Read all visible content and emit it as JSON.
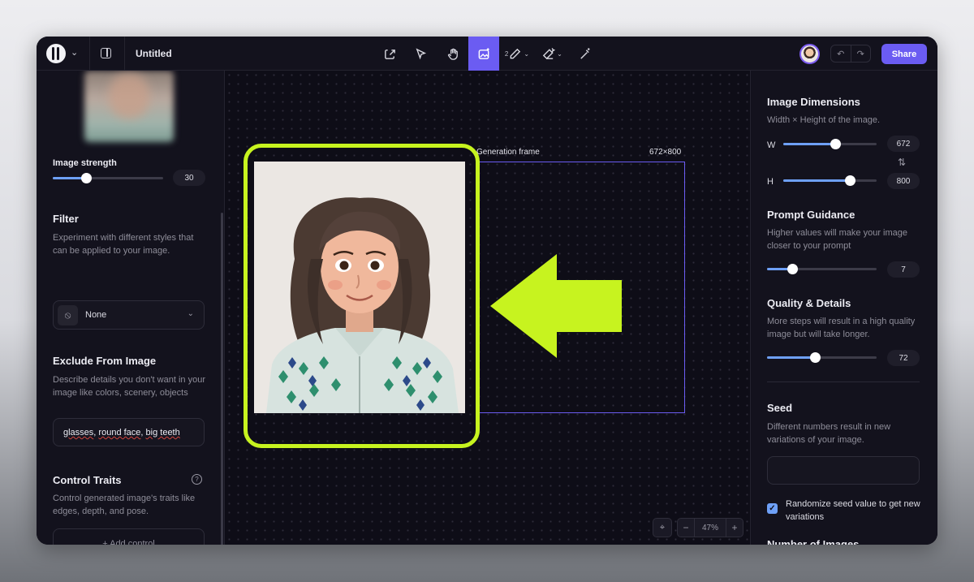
{
  "header": {
    "doc_title": "Untitled",
    "share_label": "Share",
    "tools": [
      {
        "name": "upload-tool",
        "icon": "upload-icon"
      },
      {
        "name": "select-tool",
        "icon": "cursor-icon"
      },
      {
        "name": "pan-tool",
        "icon": "hand-icon"
      },
      {
        "name": "generate-tool",
        "icon": "image-sparkle-icon",
        "active": true
      },
      {
        "name": "draw-tool",
        "icon": "pencil-icon"
      },
      {
        "name": "erase-tool",
        "icon": "eraser-icon"
      },
      {
        "name": "magic-tool",
        "icon": "magic-wand-icon"
      }
    ],
    "draw_tool_sub": "2"
  },
  "left": {
    "image_strength": {
      "label": "Image strength",
      "value": "30",
      "level": 0.3
    },
    "filter": {
      "title": "Filter",
      "description": "Experiment with different styles that can be applied to your image.",
      "selected": "None"
    },
    "exclude": {
      "title": "Exclude From Image",
      "description": "Describe details you don't want in your image like colors, scenery, objects",
      "value_parts": [
        "glasses",
        ", ",
        "round face",
        ", ",
        "big teeth"
      ]
    },
    "control_traits": {
      "title": "Control Traits",
      "description": "Control generated image's traits like edges, depth, and pose.",
      "help": "?",
      "add_label": "+ Add control"
    }
  },
  "canvas": {
    "frame_label": "Generation frame",
    "frame_size": "672×800",
    "zoom": "47%",
    "zoom_minus": "−",
    "zoom_plus": "+"
  },
  "right": {
    "dimensions": {
      "title": "Image Dimensions",
      "description": "Width × Height of the image.",
      "w_label": "W",
      "w_value": "672",
      "w_level": 0.56,
      "h_label": "H",
      "h_value": "800",
      "h_level": 0.71
    },
    "guidance": {
      "title": "Prompt Guidance",
      "description": "Higher values will make your image closer to your prompt",
      "value": "7",
      "level": 0.23
    },
    "quality": {
      "title": "Quality & Details",
      "description": "More steps will result in a high quality image but will take longer.",
      "value": "72",
      "level": 0.44
    },
    "seed": {
      "title": "Seed",
      "description": "Different numbers result in new variations of your image.",
      "randomize_label": "Randomize seed value to get new variations",
      "randomize_checked": true
    },
    "next_section_partial": "Number of Images"
  },
  "colors": {
    "accent": "#6b5cf2",
    "slider": "#6ea0f7",
    "highlight": "#c7f31f"
  }
}
